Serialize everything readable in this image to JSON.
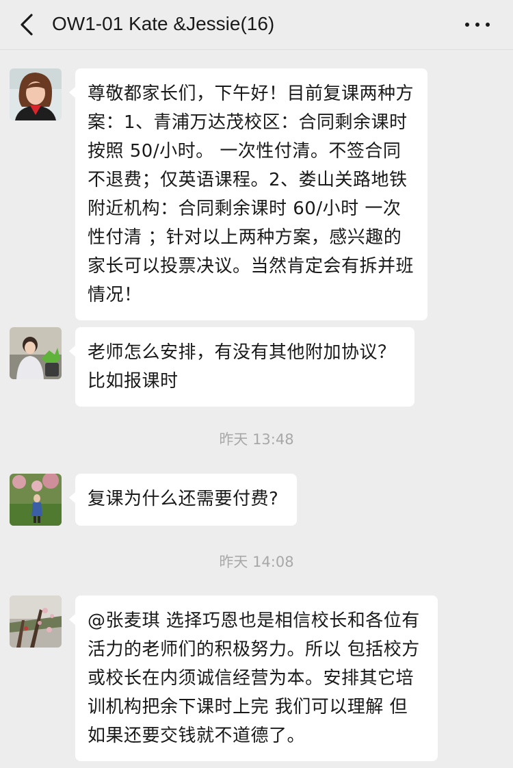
{
  "header": {
    "title": "OW1-01 Kate &Jessie(16)",
    "back_icon": "chevron-left-icon",
    "more_icon": "more-horizontal-icon"
  },
  "messages": [
    {
      "text": "尊敬都家长们，下午好！目前复课两种方案：1、青浦万达茂校区：合同剩余课时按照 50/小时。 一次性付清。不签合同不退费；仅英语课程。2、娄山关路地铁附近机构：合同剩余课时 60/小时 一次性付清 ；针对以上两种方案，感兴趣的家长可以投票决议。当然肯定会有拆并班情况！"
    },
    {
      "text": "老师怎么安排，有没有其他附加协议？比如报课时"
    },
    {
      "text": "复课为什么还需要付费?"
    },
    {
      "text": "@张麦琪  选择巧恩也是相信校长和各位有活力的老师们的积极努力。所以 包括校方或校长在内须诚信经营为本。安排其它培训机构把余下课时上完 我们可以理解 但如果还要交钱就不道德了。"
    }
  ],
  "timestamps": [
    "昨天 13:48",
    "昨天 14:08"
  ],
  "colors": {
    "background": "#ededed",
    "bubble": "#ffffff",
    "text": "#191919",
    "timestamp": "#a8a8a8"
  }
}
